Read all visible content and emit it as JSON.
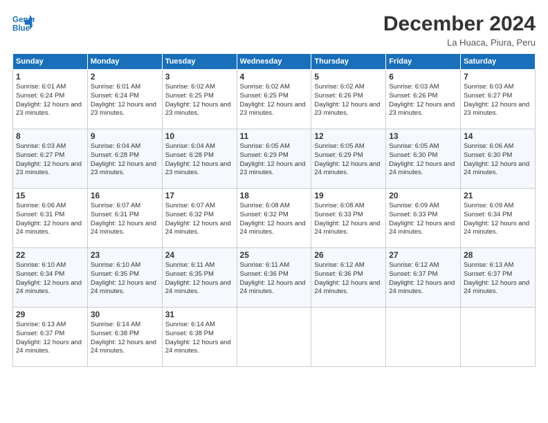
{
  "header": {
    "logo_line1": "General",
    "logo_line2": "Blue",
    "month_title": "December 2024",
    "location": "La Huaca, Piura, Peru"
  },
  "days_of_week": [
    "Sunday",
    "Monday",
    "Tuesday",
    "Wednesday",
    "Thursday",
    "Friday",
    "Saturday"
  ],
  "weeks": [
    [
      {
        "day": "1",
        "sunrise": "6:01 AM",
        "sunset": "6:24 PM",
        "daylight": "12 hours and 23 minutes."
      },
      {
        "day": "2",
        "sunrise": "6:01 AM",
        "sunset": "6:24 PM",
        "daylight": "12 hours and 23 minutes."
      },
      {
        "day": "3",
        "sunrise": "6:02 AM",
        "sunset": "6:25 PM",
        "daylight": "12 hours and 23 minutes."
      },
      {
        "day": "4",
        "sunrise": "6:02 AM",
        "sunset": "6:25 PM",
        "daylight": "12 hours and 23 minutes."
      },
      {
        "day": "5",
        "sunrise": "6:02 AM",
        "sunset": "6:26 PM",
        "daylight": "12 hours and 23 minutes."
      },
      {
        "day": "6",
        "sunrise": "6:03 AM",
        "sunset": "6:26 PM",
        "daylight": "12 hours and 23 minutes."
      },
      {
        "day": "7",
        "sunrise": "6:03 AM",
        "sunset": "6:27 PM",
        "daylight": "12 hours and 23 minutes."
      }
    ],
    [
      {
        "day": "8",
        "sunrise": "6:03 AM",
        "sunset": "6:27 PM",
        "daylight": "12 hours and 23 minutes."
      },
      {
        "day": "9",
        "sunrise": "6:04 AM",
        "sunset": "6:28 PM",
        "daylight": "12 hours and 23 minutes."
      },
      {
        "day": "10",
        "sunrise": "6:04 AM",
        "sunset": "6:28 PM",
        "daylight": "12 hours and 23 minutes."
      },
      {
        "day": "11",
        "sunrise": "6:05 AM",
        "sunset": "6:29 PM",
        "daylight": "12 hours and 23 minutes."
      },
      {
        "day": "12",
        "sunrise": "6:05 AM",
        "sunset": "6:29 PM",
        "daylight": "12 hours and 24 minutes."
      },
      {
        "day": "13",
        "sunrise": "6:05 AM",
        "sunset": "6:30 PM",
        "daylight": "12 hours and 24 minutes."
      },
      {
        "day": "14",
        "sunrise": "6:06 AM",
        "sunset": "6:30 PM",
        "daylight": "12 hours and 24 minutes."
      }
    ],
    [
      {
        "day": "15",
        "sunrise": "6:06 AM",
        "sunset": "6:31 PM",
        "daylight": "12 hours and 24 minutes."
      },
      {
        "day": "16",
        "sunrise": "6:07 AM",
        "sunset": "6:31 PM",
        "daylight": "12 hours and 24 minutes."
      },
      {
        "day": "17",
        "sunrise": "6:07 AM",
        "sunset": "6:32 PM",
        "daylight": "12 hours and 24 minutes."
      },
      {
        "day": "18",
        "sunrise": "6:08 AM",
        "sunset": "6:32 PM",
        "daylight": "12 hours and 24 minutes."
      },
      {
        "day": "19",
        "sunrise": "6:08 AM",
        "sunset": "6:33 PM",
        "daylight": "12 hours and 24 minutes."
      },
      {
        "day": "20",
        "sunrise": "6:09 AM",
        "sunset": "6:33 PM",
        "daylight": "12 hours and 24 minutes."
      },
      {
        "day": "21",
        "sunrise": "6:09 AM",
        "sunset": "6:34 PM",
        "daylight": "12 hours and 24 minutes."
      }
    ],
    [
      {
        "day": "22",
        "sunrise": "6:10 AM",
        "sunset": "6:34 PM",
        "daylight": "12 hours and 24 minutes."
      },
      {
        "day": "23",
        "sunrise": "6:10 AM",
        "sunset": "6:35 PM",
        "daylight": "12 hours and 24 minutes."
      },
      {
        "day": "24",
        "sunrise": "6:11 AM",
        "sunset": "6:35 PM",
        "daylight": "12 hours and 24 minutes."
      },
      {
        "day": "25",
        "sunrise": "6:11 AM",
        "sunset": "6:36 PM",
        "daylight": "12 hours and 24 minutes."
      },
      {
        "day": "26",
        "sunrise": "6:12 AM",
        "sunset": "6:36 PM",
        "daylight": "12 hours and 24 minutes."
      },
      {
        "day": "27",
        "sunrise": "6:12 AM",
        "sunset": "6:37 PM",
        "daylight": "12 hours and 24 minutes."
      },
      {
        "day": "28",
        "sunrise": "6:13 AM",
        "sunset": "6:37 PM",
        "daylight": "12 hours and 24 minutes."
      }
    ],
    [
      {
        "day": "29",
        "sunrise": "6:13 AM",
        "sunset": "6:37 PM",
        "daylight": "12 hours and 24 minutes."
      },
      {
        "day": "30",
        "sunrise": "6:14 AM",
        "sunset": "6:38 PM",
        "daylight": "12 hours and 24 minutes."
      },
      {
        "day": "31",
        "sunrise": "6:14 AM",
        "sunset": "6:38 PM",
        "daylight": "12 hours and 24 minutes."
      },
      null,
      null,
      null,
      null
    ]
  ],
  "labels": {
    "sunrise": "Sunrise:",
    "sunset": "Sunset:",
    "daylight": "Daylight:"
  }
}
